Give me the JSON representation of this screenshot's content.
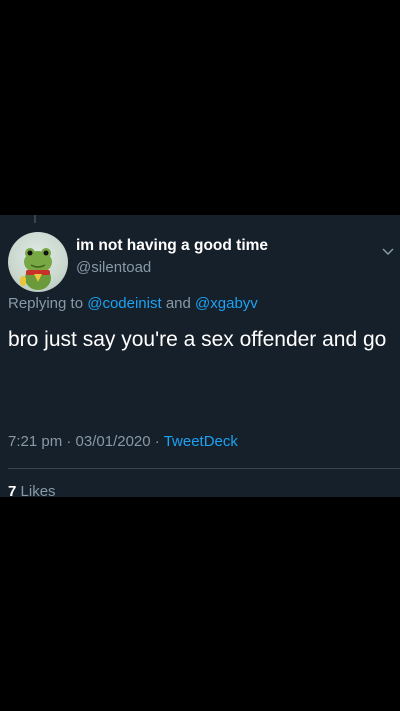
{
  "tweet": {
    "display_name": "im not having a good time",
    "handle": "@silentoad",
    "reply_prefix": "Replying to ",
    "reply_user1": "@codeinist",
    "reply_and": " and ",
    "reply_user2": "@xgabyv",
    "text": "bro just say you're a sex offender and go",
    "time": "7:21 pm",
    "date": "03/01/2020",
    "source": "TweetDeck",
    "sep": " · ",
    "likes_count": "7",
    "likes_label": "Likes"
  },
  "colors": {
    "background": "#15202b",
    "link": "#1da1f2",
    "secondary_text": "#8899a6"
  },
  "icons": {
    "chevron": "chevron-down-icon",
    "avatar": "frog-plush-avatar"
  }
}
